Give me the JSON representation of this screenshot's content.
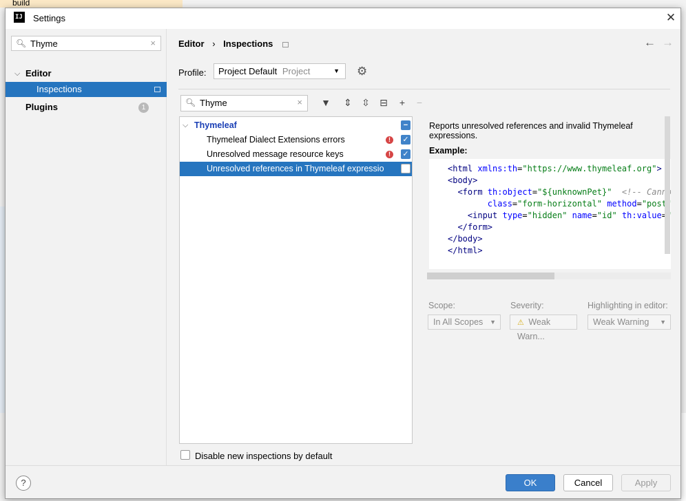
{
  "background": {
    "partial_text": "build"
  },
  "window": {
    "title": "Settings",
    "close": "✕"
  },
  "sidebar": {
    "search_value": "Thyme",
    "items": [
      {
        "label": "Editor",
        "expanded": true
      },
      {
        "label": "Inspections",
        "selected": true
      },
      {
        "label": "Plugins",
        "badge": "1"
      }
    ]
  },
  "main": {
    "breadcrumb": {
      "parent": "Editor",
      "separator": "›",
      "current": "Inspections"
    },
    "nav": {
      "back": "←",
      "forward": "→"
    },
    "profile": {
      "label": "Profile:",
      "value": "Project Default",
      "scope": "Project"
    },
    "inspection_search": "Thyme",
    "tree": {
      "group": "Thymeleaf",
      "items": [
        {
          "label": "Thymeleaf Dialect Extensions errors",
          "checked": true,
          "error": true
        },
        {
          "label": "Unresolved message resource keys",
          "checked": true,
          "error": true
        },
        {
          "label": "Unresolved references in Thymeleaf expression",
          "checked": false,
          "selected": true
        }
      ]
    },
    "disable_new_label": "Disable new inspections by default",
    "description": "Reports unresolved references and invalid Thymeleaf expressions.",
    "example_label": "Example:",
    "options": {
      "scope_label": "Scope:",
      "scope_value": "In All Scopes",
      "severity_label": "Severity:",
      "severity_value": "Weak Warn...",
      "highlight_label": "Highlighting in editor:",
      "highlight_value": "Weak Warning"
    }
  },
  "footer": {
    "help": "?",
    "ok": "OK",
    "cancel": "Cancel",
    "apply": "Apply"
  },
  "colors": {
    "selection": "#2675bf",
    "ok_button": "#3a7fcb",
    "checkbox": "#4083c9",
    "error_icon": "#d64545"
  }
}
